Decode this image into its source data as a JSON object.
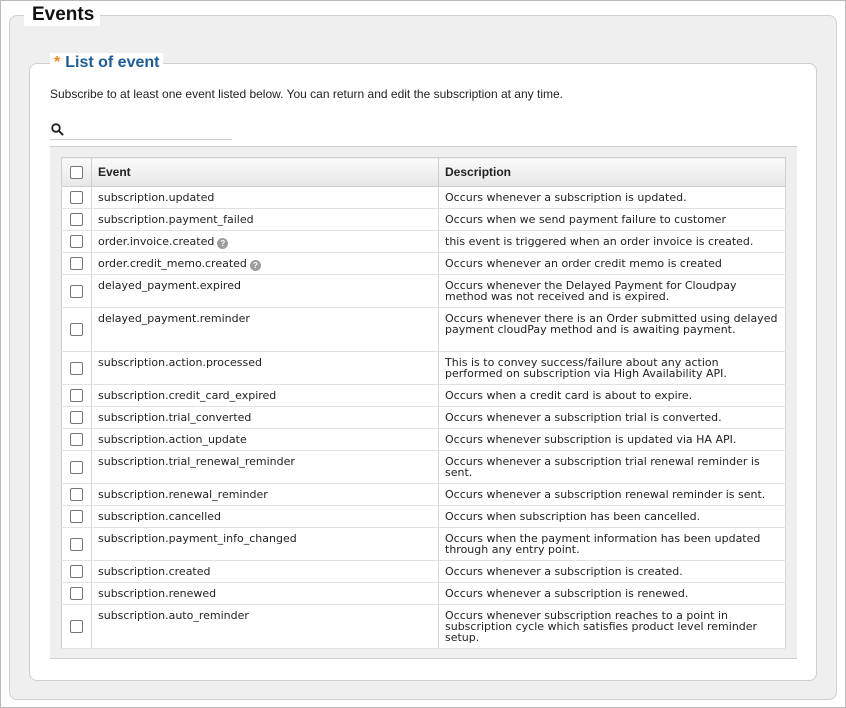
{
  "outer_title": "Events",
  "section_title": "List of event",
  "required_mark": "*",
  "intro_text": "Subscribe to at least one event listed below. You can return and edit the subscription at any time.",
  "search": {
    "placeholder": "",
    "value": ""
  },
  "table": {
    "columns": [
      "Event",
      "Description"
    ],
    "rows": [
      {
        "event": "subscription.updated",
        "help": false,
        "description": "Occurs whenever a subscription is updated."
      },
      {
        "event": "subscription.payment_failed",
        "help": false,
        "description": "Occurs when we send payment failure to customer"
      },
      {
        "event": "order.invoice.created",
        "help": true,
        "description": "this event is triggered when an order invoice is created."
      },
      {
        "event": "order.credit_memo.created",
        "help": true,
        "description": "Occurs whenever an order credit memo is created"
      },
      {
        "event": "delayed_payment.expired",
        "help": false,
        "description": "Occurs whenever the Delayed Payment for Cloudpay method was not received and is expired."
      },
      {
        "event": "delayed_payment.reminder",
        "help": false,
        "description": "Occurs whenever there is an Order submitted using delayed payment cloudPay method and is awaiting payment."
      },
      {
        "event": "subscription.action.processed",
        "help": false,
        "description": "This is to convey success/failure about any action performed on subscription via High Availability API."
      },
      {
        "event": "subscription.credit_card_expired",
        "help": false,
        "description": "Occurs when a credit card is about to expire."
      },
      {
        "event": "subscription.trial_converted",
        "help": false,
        "description": "Occurs whenever a subscription trial is converted."
      },
      {
        "event": "subscription.action_update",
        "help": false,
        "description": "Occurs whenever subscription is updated via HA API."
      },
      {
        "event": "subscription.trial_renewal_reminder",
        "help": false,
        "description": "Occurs whenever a subscription trial renewal reminder is sent."
      },
      {
        "event": "subscription.renewal_reminder",
        "help": false,
        "description": "Occurs whenever a subscription renewal reminder is sent."
      },
      {
        "event": "subscription.cancelled",
        "help": false,
        "description": "Occurs when subscription has been cancelled."
      },
      {
        "event": "subscription.payment_info_changed",
        "help": false,
        "description": "Occurs when the payment information has been updated through any entry point."
      },
      {
        "event": "subscription.created",
        "help": false,
        "description": "Occurs whenever a subscription is created."
      },
      {
        "event": "subscription.renewed",
        "help": false,
        "description": "Occurs whenever a subscription is renewed."
      },
      {
        "event": "subscription.auto_reminder",
        "help": false,
        "description": "Occurs whenever subscription reaches to a point in subscription cycle which satisfies product level reminder setup."
      }
    ]
  },
  "help_glyph": "?",
  "icons": {
    "search": "search-icon",
    "help": "help-icon"
  },
  "colors": {
    "section_title": "#1a5d9a",
    "required": "#f08a24"
  }
}
